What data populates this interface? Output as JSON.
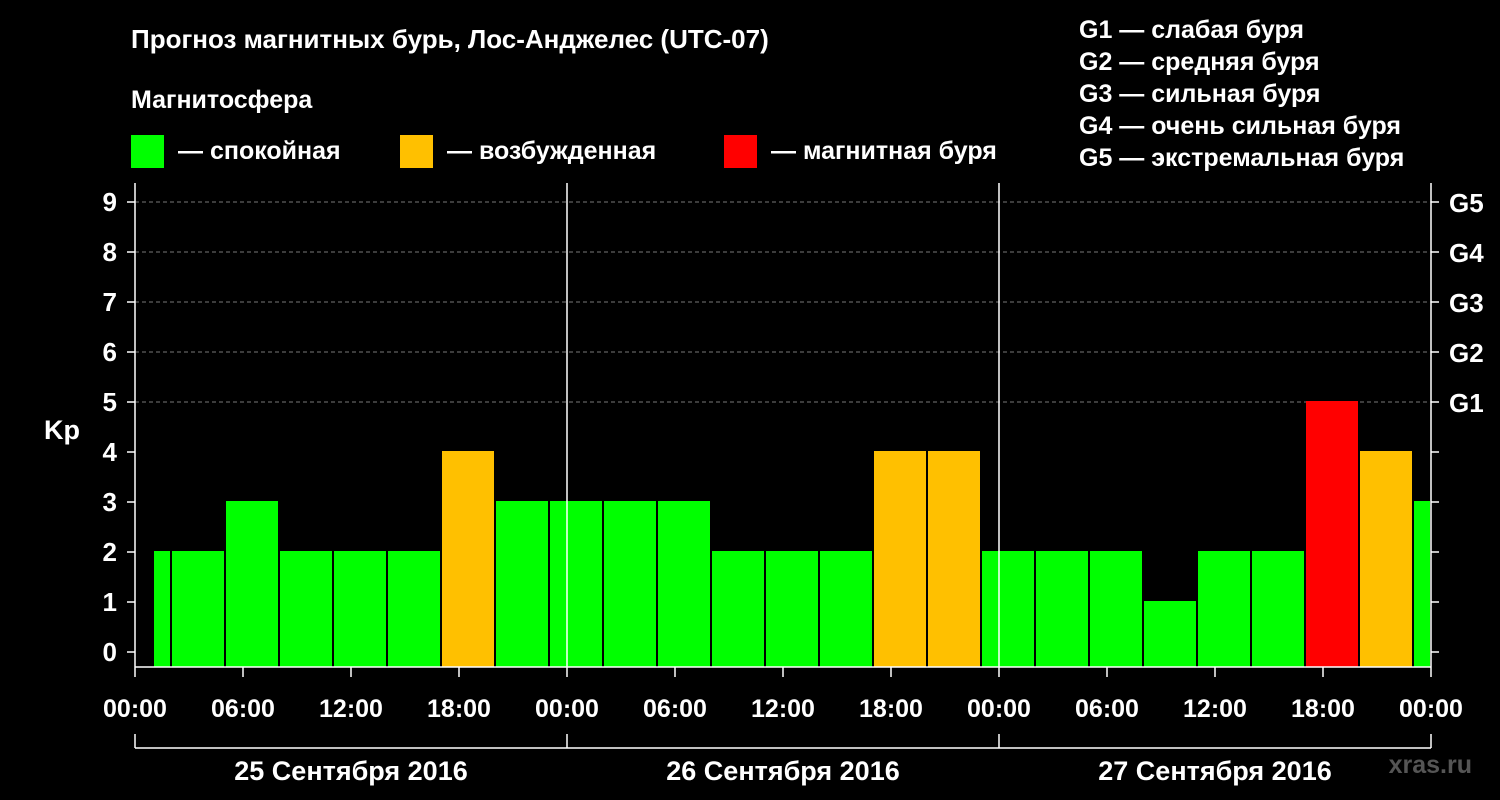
{
  "title": "Прогноз магнитных бурь, Лос-Анджелес (UTC-07)",
  "magnetosphere_label": "Магнитосфера",
  "legend": [
    {
      "text": "— спокойная",
      "color": "#00ff00"
    },
    {
      "text": "— возбужденная",
      "color": "#ffc000"
    },
    {
      "text": "— магнитная буря",
      "color": "#ff0000"
    }
  ],
  "g_legend": [
    "G1 — слабая буря",
    "G2 — средняя буря",
    "G3 — сильная буря",
    "G4 — очень сильная буря",
    "G5 — экстремальная буря"
  ],
  "watermark": "xras.ru",
  "chart_data": {
    "type": "bar",
    "ylabel": "Kp",
    "ylim": [
      0,
      9
    ],
    "yticks": [
      "0",
      "1",
      "2",
      "3",
      "4",
      "5",
      "6",
      "7",
      "8",
      "9"
    ],
    "right_ticks": [
      {
        "value": 5,
        "label": "G1"
      },
      {
        "value": 6,
        "label": "G2"
      },
      {
        "value": 7,
        "label": "G3"
      },
      {
        "value": 8,
        "label": "G4"
      },
      {
        "value": 9,
        "label": "G5"
      }
    ],
    "xtick_labels": [
      "00:00",
      "06:00",
      "12:00",
      "18:00",
      "00:00",
      "06:00",
      "12:00",
      "18:00",
      "00:00",
      "06:00",
      "12:00",
      "18:00",
      "00:00"
    ],
    "days": [
      "25 Сентября 2016",
      "26 Сентября 2016",
      "27 Сентября 2016"
    ],
    "grid": true,
    "colors": {
      "quiet": "#00ff00",
      "active": "#ffc000",
      "storm": "#ff0000"
    },
    "bars": [
      {
        "start": "25 Sep 01:00",
        "end": "25 Sep 02:00",
        "kp": 2,
        "level": "quiet"
      },
      {
        "start": "25 Sep 02:00",
        "end": "25 Sep 05:00",
        "kp": 2,
        "level": "quiet"
      },
      {
        "start": "25 Sep 05:00",
        "end": "25 Sep 08:00",
        "kp": 3,
        "level": "quiet"
      },
      {
        "start": "25 Sep 08:00",
        "end": "25 Sep 11:00",
        "kp": 2,
        "level": "quiet"
      },
      {
        "start": "25 Sep 11:00",
        "end": "25 Sep 14:00",
        "kp": 2,
        "level": "quiet"
      },
      {
        "start": "25 Sep 14:00",
        "end": "25 Sep 17:00",
        "kp": 2,
        "level": "quiet"
      },
      {
        "start": "25 Sep 17:00",
        "end": "25 Sep 20:00",
        "kp": 4,
        "level": "active"
      },
      {
        "start": "25 Sep 20:00",
        "end": "25 Sep 23:00",
        "kp": 3,
        "level": "quiet"
      },
      {
        "start": "25 Sep 23:00",
        "end": "26 Sep 02:00",
        "kp": 3,
        "level": "quiet"
      },
      {
        "start": "26 Sep 02:00",
        "end": "26 Sep 05:00",
        "kp": 3,
        "level": "quiet"
      },
      {
        "start": "26 Sep 05:00",
        "end": "26 Sep 08:00",
        "kp": 3,
        "level": "quiet"
      },
      {
        "start": "26 Sep 08:00",
        "end": "26 Sep 11:00",
        "kp": 2,
        "level": "quiet"
      },
      {
        "start": "26 Sep 11:00",
        "end": "26 Sep 14:00",
        "kp": 2,
        "level": "quiet"
      },
      {
        "start": "26 Sep 14:00",
        "end": "26 Sep 17:00",
        "kp": 2,
        "level": "quiet"
      },
      {
        "start": "26 Sep 17:00",
        "end": "26 Sep 20:00",
        "kp": 4,
        "level": "active"
      },
      {
        "start": "26 Sep 20:00",
        "end": "26 Sep 23:00",
        "kp": 4,
        "level": "active"
      },
      {
        "start": "26 Sep 23:00",
        "end": "27 Sep 02:00",
        "kp": 2,
        "level": "quiet"
      },
      {
        "start": "27 Sep 02:00",
        "end": "27 Sep 05:00",
        "kp": 2,
        "level": "quiet"
      },
      {
        "start": "27 Sep 05:00",
        "end": "27 Sep 08:00",
        "kp": 2,
        "level": "quiet"
      },
      {
        "start": "27 Sep 08:00",
        "end": "27 Sep 11:00",
        "kp": 1,
        "level": "quiet"
      },
      {
        "start": "27 Sep 11:00",
        "end": "27 Sep 14:00",
        "kp": 2,
        "level": "quiet"
      },
      {
        "start": "27 Sep 14:00",
        "end": "27 Sep 17:00",
        "kp": 2,
        "level": "quiet"
      },
      {
        "start": "27 Sep 17:00",
        "end": "27 Sep 20:00",
        "kp": 5,
        "level": "storm"
      },
      {
        "start": "27 Sep 20:00",
        "end": "27 Sep 23:00",
        "kp": 4,
        "level": "active"
      },
      {
        "start": "27 Sep 23:00",
        "end": "28 Sep 00:00",
        "kp": 3,
        "level": "quiet"
      }
    ]
  }
}
